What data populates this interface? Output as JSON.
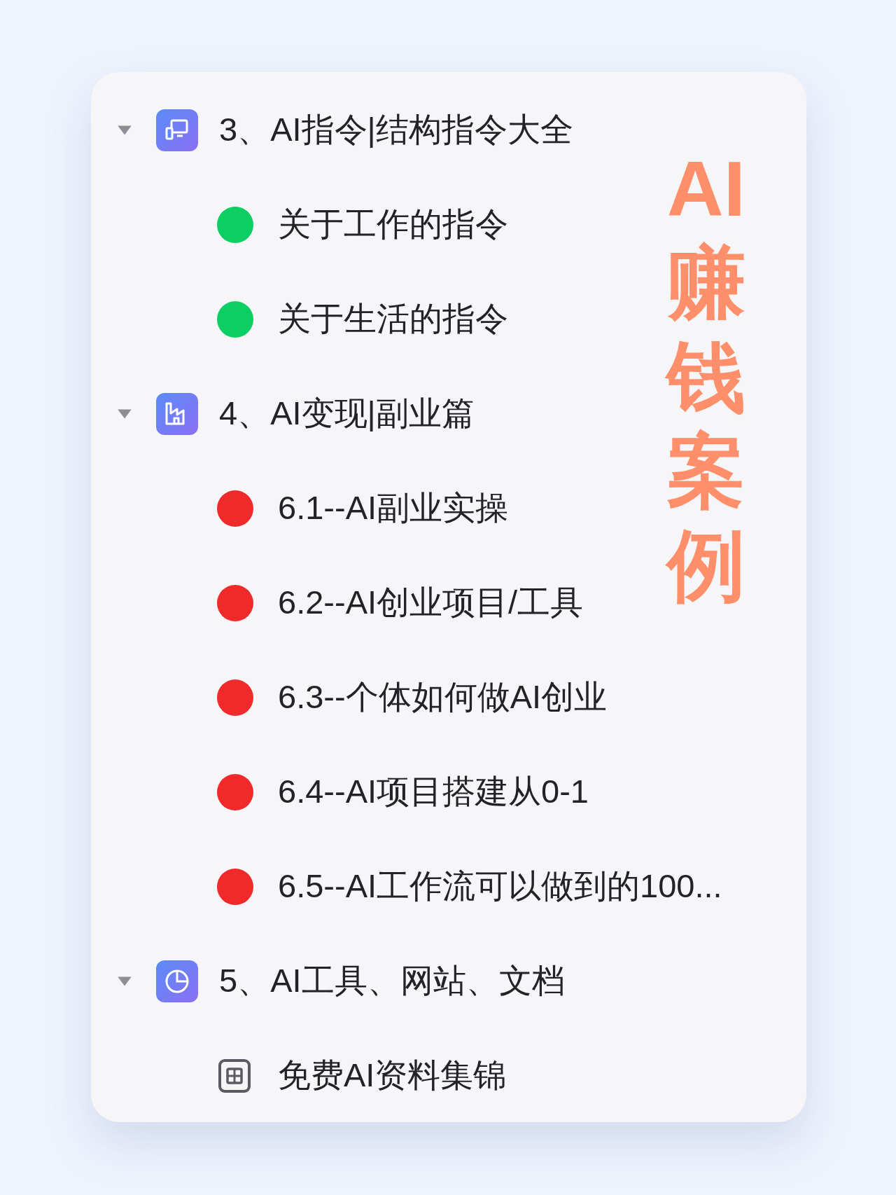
{
  "sections": [
    {
      "title": "3、AI指令|结构指令大全",
      "expanded": true,
      "children": [
        {
          "kind": "dot",
          "color": "#0ccf63",
          "label": "关于工作的指令"
        },
        {
          "kind": "dot",
          "color": "#0ccf63",
          "label": "关于生活的指令"
        }
      ]
    },
    {
      "title": "4、AI变现|副业篇",
      "expanded": true,
      "children": [
        {
          "kind": "dot",
          "color": "#f02a2a",
          "label": "6.1--AI副业实操"
        },
        {
          "kind": "dot",
          "color": "#f02a2a",
          "label": "6.2--AI创业项目/工具"
        },
        {
          "kind": "dot",
          "color": "#f02a2a",
          "label": "6.3--个体如何做AI创业"
        },
        {
          "kind": "dot",
          "color": "#f02a2a",
          "label": "6.4--AI项目搭建从0-1"
        },
        {
          "kind": "dot",
          "color": "#f02a2a",
          "label": "6.5--AI工作流可以做到的100..."
        }
      ]
    },
    {
      "title": "5、AI工具、网站、文档",
      "expanded": true,
      "children": [
        {
          "kind": "doc",
          "label": "免费AI资料集锦"
        }
      ]
    }
  ],
  "overlay_title": "AI赚钱案例"
}
